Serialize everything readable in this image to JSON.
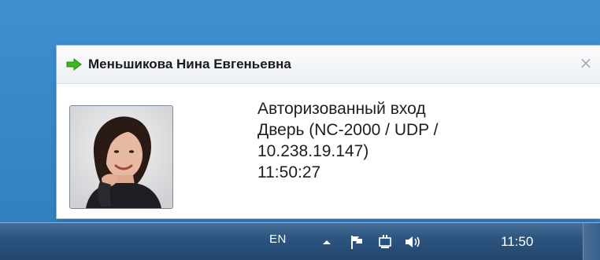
{
  "notification": {
    "title": "Меньшикова Нина Евгеньевна",
    "close_glyph": "×",
    "lines": [
      "Авторизованный вход",
      "Дверь (NC-2000 / UDP /",
      "10.238.19.147)",
      "11:50:27"
    ],
    "arrow_icon": "green-arrow-right-icon",
    "arrow_color": "#3cb91e"
  },
  "taskbar": {
    "language": "EN",
    "clock": "11:50",
    "tray_icons": [
      "show-hidden-icons-icon",
      "action-center-flag-icon",
      "network-icon",
      "volume-icon"
    ]
  }
}
